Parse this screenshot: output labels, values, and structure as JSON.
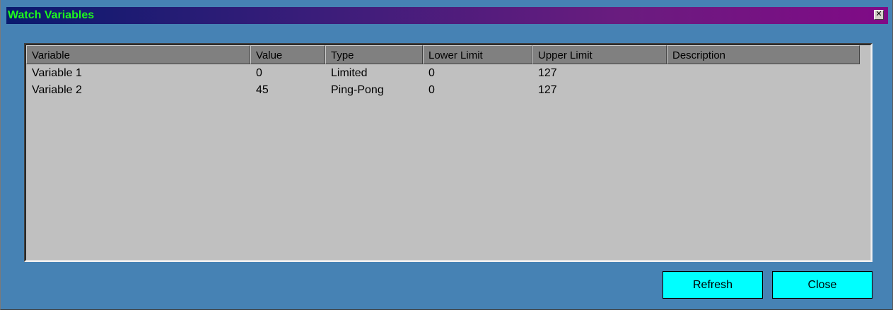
{
  "window": {
    "title": "Watch Variables",
    "close_glyph": "✕",
    "colors": {
      "background": "#4682b4",
      "title_text": "#1dfa1d",
      "title_gradient_start": "#0a1a6e",
      "title_gradient_end": "#800a86",
      "button": "#00ffff"
    }
  },
  "table": {
    "columns": [
      "Variable",
      "Value",
      "Type",
      "Lower Limit",
      "Upper Limit",
      "Description"
    ],
    "rows": [
      [
        "Variable 1",
        "0",
        "Limited",
        "0",
        "127",
        ""
      ],
      [
        "Variable 2",
        "45",
        "Ping-Pong",
        "0",
        "127",
        ""
      ]
    ]
  },
  "buttons": {
    "refresh_label": "Refresh",
    "close_label": "Close"
  }
}
